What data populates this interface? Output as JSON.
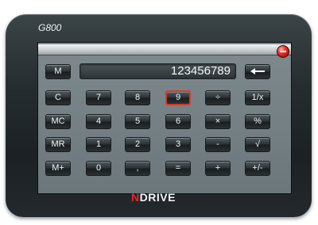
{
  "device": {
    "model": "G800"
  },
  "brand": {
    "first": "N",
    "rest": "DRIVE"
  },
  "display": {
    "value": "123456789"
  },
  "keys": {
    "memory": "M",
    "backspace_icon": "backspace-arrow-icon",
    "c": "C",
    "mc": "MC",
    "mr": "MR",
    "mplus": "M+",
    "d7": "7",
    "d8": "8",
    "d9": "9",
    "d4": "4",
    "d5": "5",
    "d6": "6",
    "d1": "1",
    "d2": "2",
    "d3": "3",
    "d0": "0",
    "dot": ",",
    "equals": "=",
    "divide": "÷",
    "multiply": "×",
    "minus": "-",
    "plus": "+",
    "reciprocal": "1/x",
    "percent": "%",
    "sqrt": "√",
    "negate": "+/-"
  },
  "colors": {
    "accent": "#d63a2a",
    "close": "#e8322a"
  }
}
